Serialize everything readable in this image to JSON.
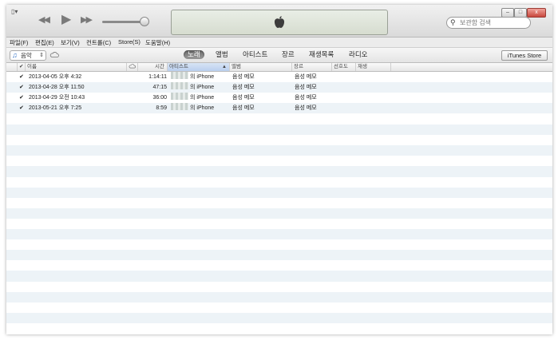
{
  "toolbar": {
    "sysmenu_label": "▯▾",
    "rewind_glyph": "◀◀",
    "play_glyph": "▶",
    "forward_glyph": "▶▶",
    "volume_level": 0.9,
    "search_placeholder": "보관함 검색",
    "minimize": "–",
    "maximize": "□",
    "close": "x"
  },
  "menu": [
    "파일(F)",
    "편집(E)",
    "보기(V)",
    "컨트롤(C)",
    "Store(S)",
    "도움말(H)"
  ],
  "source": {
    "library_label": "음악",
    "arrow": "⇕"
  },
  "tabs": [
    {
      "label": "노래",
      "active": true
    },
    {
      "label": "앨범",
      "active": false
    },
    {
      "label": "아티스트",
      "active": false
    },
    {
      "label": "장르",
      "active": false
    },
    {
      "label": "재생목록",
      "active": false
    },
    {
      "label": "라디오",
      "active": false
    }
  ],
  "store_button": "iTunes Store",
  "table": {
    "headers": {
      "check": "✔",
      "name": "이름",
      "time": "시간",
      "artist": "아티스트",
      "sort_arrow": "▲",
      "album": "앨범",
      "genre": "장르",
      "rating": "선호도",
      "plays": "재생"
    },
    "rows": [
      {
        "check": "✔",
        "name": "2013-04-05 오후 4:32",
        "time": "1:14:11",
        "artist_suffix": "의 iPhone",
        "album": "음성 메모",
        "genre": "음성 메모"
      },
      {
        "check": "✔",
        "name": "2013-04-28 오후 11:50",
        "time": "47:15",
        "artist_suffix": "의 iPhone",
        "album": "음성 메모",
        "genre": "음성 메모"
      },
      {
        "check": "✔",
        "name": "2013-04-29 오전 10:43",
        "time": "36:00",
        "artist_suffix": "의 iPhone",
        "album": "음성 메모",
        "genre": "음성 메모"
      },
      {
        "check": "✔",
        "name": "2013-05-21 오후 7:25",
        "time": "8:59",
        "artist_suffix": "의 iPhone",
        "album": "음성 메모",
        "genre": "음성 메모"
      }
    ]
  }
}
